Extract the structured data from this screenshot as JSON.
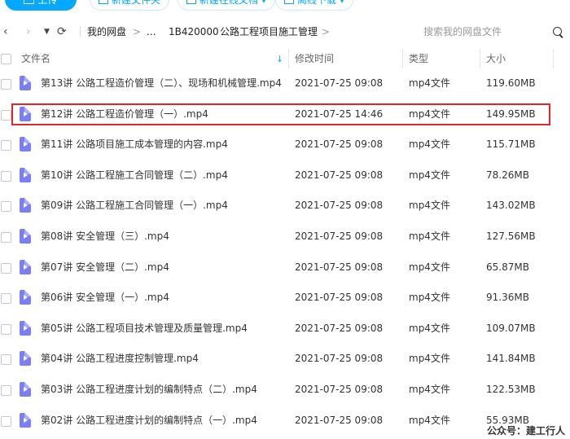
{
  "toolbar": {
    "upload_label": "上传",
    "new_folder_label": "新建文件夹",
    "new_online_doc_label": "新建在线文档",
    "offline_download_label": "离线下载",
    "right_glyph": "2 -"
  },
  "nav": {
    "root_label": "我的网盘",
    "ellipsis": "...",
    "crumb1": "1B420000",
    "crumb2": "公路工程项目施工管理",
    "crumb_arrow": ">",
    "search_placeholder": "搜索我的网盘文件"
  },
  "header": {
    "name": "文件名",
    "modified": "修改时间",
    "type": "类型",
    "size": "大小"
  },
  "files": [
    {
      "name": "第13讲   公路工程造价管理（二）、现场和机械管理.mp4",
      "modified": "2021-07-25 09:08",
      "type": "mp4文件",
      "size": "119.60MB"
    },
    {
      "name": "第12讲   公路工程造价管理（一）.mp4",
      "modified": "2021-07-25 14:46",
      "type": "mp4文件",
      "size": "149.95MB"
    },
    {
      "name": "第11讲   公路项目施工成本管理的内容.mp4",
      "modified": "2021-07-25 09:08",
      "type": "mp4文件",
      "size": "115.71MB"
    },
    {
      "name": "第10讲   公路工程施工合同管理（二）.mp4",
      "modified": "2021-07-25 09:08",
      "type": "mp4文件",
      "size": "78.26MB"
    },
    {
      "name": "第09讲   公路工程施工合同管理（一）.mp4",
      "modified": "2021-07-25 09:08",
      "type": "mp4文件",
      "size": "143.02MB"
    },
    {
      "name": "第08讲   安全管理（三）.mp4",
      "modified": "2021-07-25 09:08",
      "type": "mp4文件",
      "size": "127.56MB"
    },
    {
      "name": "第07讲   安全管理（二）.mp4",
      "modified": "2021-07-25 09:08",
      "type": "mp4文件",
      "size": "65.87MB"
    },
    {
      "name": "第06讲   安全管理（一）.mp4",
      "modified": "2021-07-25 09:08",
      "type": "mp4文件",
      "size": "91.36MB"
    },
    {
      "name": "第05讲   公路工程项目技术管理及质量管理.mp4",
      "modified": "2021-07-25 09:08",
      "type": "mp4文件",
      "size": "109.07MB"
    },
    {
      "name": "第04讲   公路工程进度控制管理.mp4",
      "modified": "2021-07-25 09:08",
      "type": "mp4文件",
      "size": "141.84MB"
    },
    {
      "name": "第03讲   公路工程进度计划的编制特点（二）.mp4",
      "modified": "2021-07-25 09:08",
      "type": "mp4文件",
      "size": "122.53MB"
    },
    {
      "name": "第02讲   公路工程进度计划的编制特点（一）.mp4",
      "modified": "2021-07-25 09:08",
      "type": "mp4文件",
      "size": "55.93MB"
    }
  ],
  "watermark": "公众号：建工行人",
  "colors": {
    "accent": "#06a7ff",
    "file_icon": "#7a7ff7",
    "highlight_border": "#e2262c"
  }
}
